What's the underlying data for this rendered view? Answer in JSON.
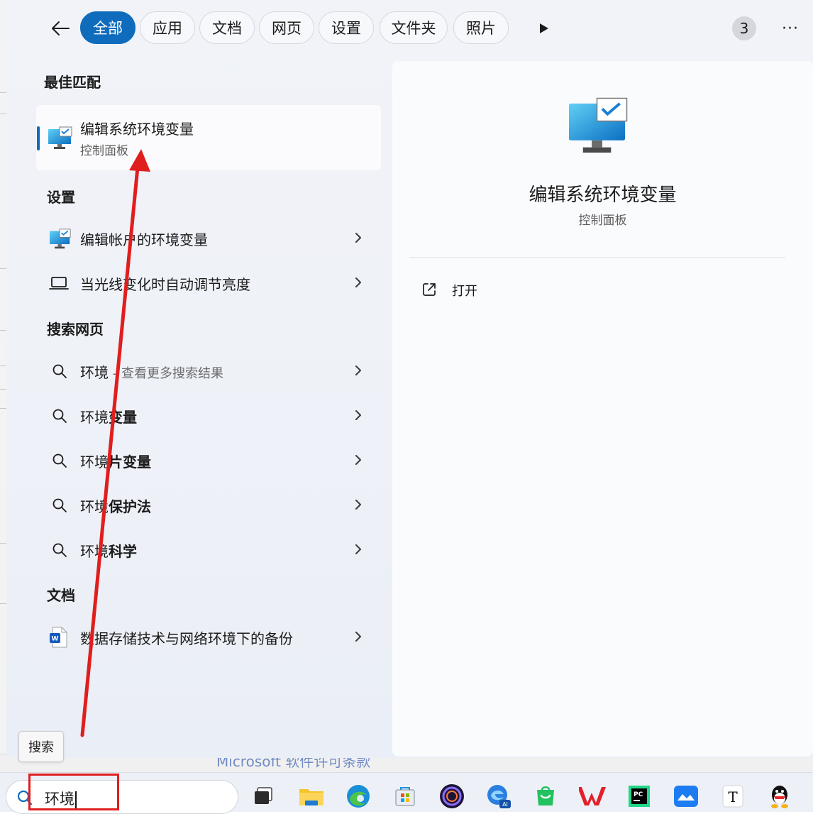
{
  "filters": {
    "back_label": "←",
    "chips": [
      {
        "label": "全部",
        "active": true
      },
      {
        "label": "应用",
        "active": false
      },
      {
        "label": "文档",
        "active": false
      },
      {
        "label": "网页",
        "active": false
      },
      {
        "label": "设置",
        "active": false
      },
      {
        "label": "文件夹",
        "active": false
      },
      {
        "label": "照片",
        "active": false
      }
    ],
    "badge_count": "3",
    "menu_label": "···"
  },
  "best_match": {
    "heading": "最佳匹配",
    "title": "编辑系统环境变量",
    "subtitle": "控制面板"
  },
  "settings": {
    "heading": "设置",
    "items": [
      {
        "label": "编辑帐户的环境变量",
        "icon": "monitor-check-icon"
      },
      {
        "label": "当光线变化时自动调节亮度",
        "icon": "laptop-icon"
      }
    ]
  },
  "web": {
    "heading": "搜索网页",
    "first": {
      "query": "环境",
      "suffix": " - 查看更多搜索结果"
    },
    "suggestions": [
      {
        "prefix": "环境",
        "bold": "变量"
      },
      {
        "prefix": "环境",
        "bold": "片变量"
      },
      {
        "prefix": "环境",
        "bold": "保护法"
      },
      {
        "prefix": "环境",
        "bold": "科学"
      }
    ]
  },
  "documents": {
    "heading": "文档",
    "items": [
      {
        "label": "数据存储技术与网络环境下的备份",
        "icon": "word-document-icon"
      }
    ]
  },
  "preview": {
    "title": "编辑系统环境变量",
    "subtitle": "控制面板",
    "action_open": "打开"
  },
  "tooltip": "搜索",
  "taskbar": {
    "search_value": "环境",
    "apps": [
      "task-view-icon",
      "file-explorer-icon",
      "edge-icon",
      "microsoft-store-icon",
      "copilot-icon",
      "edge-ai-icon",
      "wechat-store-icon",
      "wps-icon",
      "pycharm-icon",
      "feishu-icon",
      "typora-icon",
      "qq-icon"
    ]
  },
  "background": {
    "partial_text": "Microsoft 软件许可条款"
  },
  "colors": {
    "accent": "#0f6cbd",
    "annotation": "#e01e1e"
  }
}
